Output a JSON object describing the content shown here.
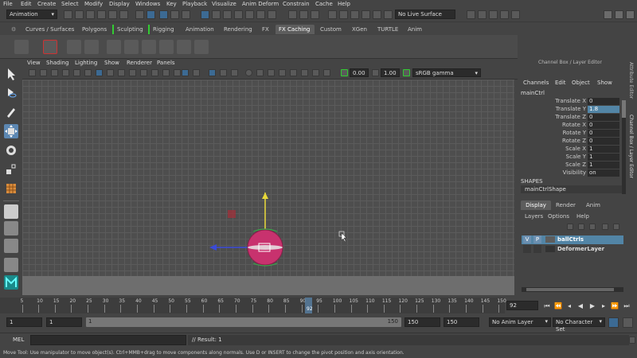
{
  "menu": [
    "File",
    "Edit",
    "Create",
    "Select",
    "Modify",
    "Display",
    "Windows",
    "Key",
    "Playback",
    "Visualize",
    "Anim Deform",
    "Constrain",
    "Cache",
    "Help"
  ],
  "status_line": {
    "mode": "Animation",
    "live_surface": "No Live Surface"
  },
  "shelf_tabs": [
    "Curves / Surfaces",
    "Polygons",
    "Sculpting",
    "Rigging",
    "Animation",
    "Rendering",
    "FX",
    "FX Caching",
    "Custom",
    "XGen",
    "TURTLE",
    "Anim"
  ],
  "active_shelf_tab": "FX Caching",
  "viewport": {
    "menu": [
      "View",
      "Shading",
      "Lighting",
      "Show",
      "Renderer",
      "Panels"
    ],
    "near_value": "0.00",
    "far_value": "1.00",
    "color_space": "sRGB gamma"
  },
  "channel_box": {
    "title": "Channel Box / Layer Editor",
    "menu": [
      "Channels",
      "Edit",
      "Object",
      "Show"
    ],
    "object": "mainCtrl",
    "attributes": [
      {
        "label": "Translate X",
        "value": "0"
      },
      {
        "label": "Translate Y",
        "value": "1.8"
      },
      {
        "label": "Translate Z",
        "value": "0"
      },
      {
        "label": "Rotate X",
        "value": "0"
      },
      {
        "label": "Rotate Y",
        "value": "0"
      },
      {
        "label": "Rotate Z",
        "value": "0"
      },
      {
        "label": "Scale X",
        "value": "1"
      },
      {
        "label": "Scale Y",
        "value": "1"
      },
      {
        "label": "Scale Z",
        "value": "1"
      },
      {
        "label": "Visibility",
        "value": "on"
      }
    ],
    "shapes_heading": "SHAPES",
    "shape": "mainCtrlShape",
    "side_tabs": [
      "Attribute Editor",
      "Channel Box / Layer Editor"
    ]
  },
  "layer_editor": {
    "tabs": [
      "Display",
      "Render",
      "Anim"
    ],
    "menu": [
      "Layers",
      "Options",
      "Help"
    ],
    "layers": [
      {
        "v": "V",
        "p": "P",
        "name": "ballCtrls"
      },
      {
        "v": "",
        "p": "",
        "name": "DeformerLayer"
      }
    ]
  },
  "timeline": {
    "ticks": [
      "5",
      "10",
      "15",
      "20",
      "25",
      "30",
      "35",
      "40",
      "45",
      "50",
      "55",
      "60",
      "65",
      "70",
      "75",
      "80",
      "85",
      "90",
      "95",
      "100",
      "105",
      "110",
      "115",
      "120",
      "125",
      "130",
      "135",
      "140",
      "145",
      "150"
    ],
    "current_frame": "92",
    "current_frame_field": "92"
  },
  "range": {
    "start": "1",
    "inner_start": "1",
    "slider_start": "1",
    "slider_end": "150",
    "inner_end": "150",
    "end": "150",
    "anim_layer": "No Anim Layer",
    "character_set": "No Character Set"
  },
  "command_line": {
    "label": "MEL",
    "result": "// Result: 1"
  },
  "help_line": "Move Tool: Use manipulator to move object(s). Ctrl+MMB+drag to move components along normals. Use D or INSERT to change the pivot position and axis orientation.",
  "colors": {
    "selection": "#5285a6",
    "sphere": "#c8326e",
    "y_axis": "#e8d83a",
    "x_axis": "#3a4ad8"
  }
}
